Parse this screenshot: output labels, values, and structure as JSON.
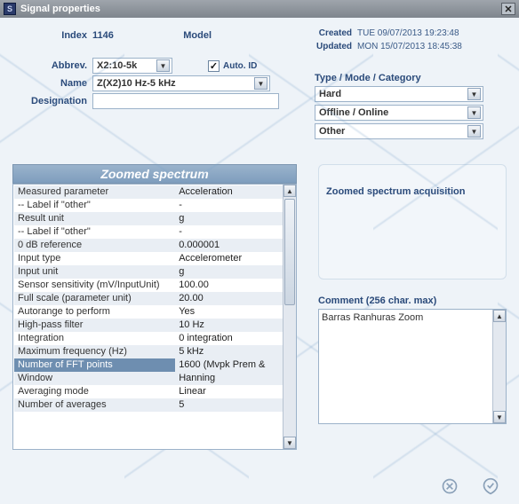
{
  "window": {
    "title": "Signal properties"
  },
  "meta": {
    "index_label": "Index",
    "index_value": "1146",
    "model_label": "Model",
    "created_label": "Created",
    "created_value": "TUE 09/07/2013 19:23:48",
    "updated_label": "Updated",
    "updated_value": "MON 15/07/2013 18:45:38"
  },
  "fields": {
    "abbrev_label": "Abbrev.",
    "abbrev_value": "X2:10-5k",
    "autoid_label": "Auto. ID",
    "autoid_checked": "✓",
    "name_label": "Name",
    "name_value": "Z(X2)10 Hz-5 kHz",
    "designation_label": "Designation",
    "designation_value": ""
  },
  "tmc": {
    "heading": "Type / Mode / Category",
    "type_value": "Hard",
    "mode_value": "Offline / Online",
    "category_value": "Other"
  },
  "params": {
    "title": "Zoomed spectrum",
    "rows": [
      {
        "k": "Measured parameter",
        "v": "Acceleration"
      },
      {
        "k": "-- Label if \"other\"",
        "v": "-"
      },
      {
        "k": "Result unit",
        "v": "g"
      },
      {
        "k": "-- Label if \"other\"",
        "v": "-"
      },
      {
        "k": "0 dB reference",
        "v": "0.000001"
      },
      {
        "k": "Input type",
        "v": "Accelerometer"
      },
      {
        "k": "Input unit",
        "v": "g"
      },
      {
        "k": "Sensor sensitivity (mV/InputUnit)",
        "v": "100.00"
      },
      {
        "k": "Full scale (parameter unit)",
        "v": "20.00"
      },
      {
        "k": "Autorange to perform",
        "v": "Yes"
      },
      {
        "k": "High-pass filter",
        "v": "10 Hz"
      },
      {
        "k": "Integration",
        "v": "0 integration"
      },
      {
        "k": "Maximum frequency (Hz)",
        "v": "5 kHz"
      },
      {
        "k": "Number of FFT points",
        "v": "1600 (Mvpk Prem &",
        "selected": true
      },
      {
        "k": "Window",
        "v": "Hanning"
      },
      {
        "k": "Averaging mode",
        "v": "Linear"
      },
      {
        "k": "Number of averages",
        "v": "5"
      }
    ]
  },
  "right": {
    "acq_text": "Zoomed spectrum acquisition",
    "comment_label": "Comment (256 char. max)",
    "comment_value": "Barras Ranhuras Zoom"
  }
}
